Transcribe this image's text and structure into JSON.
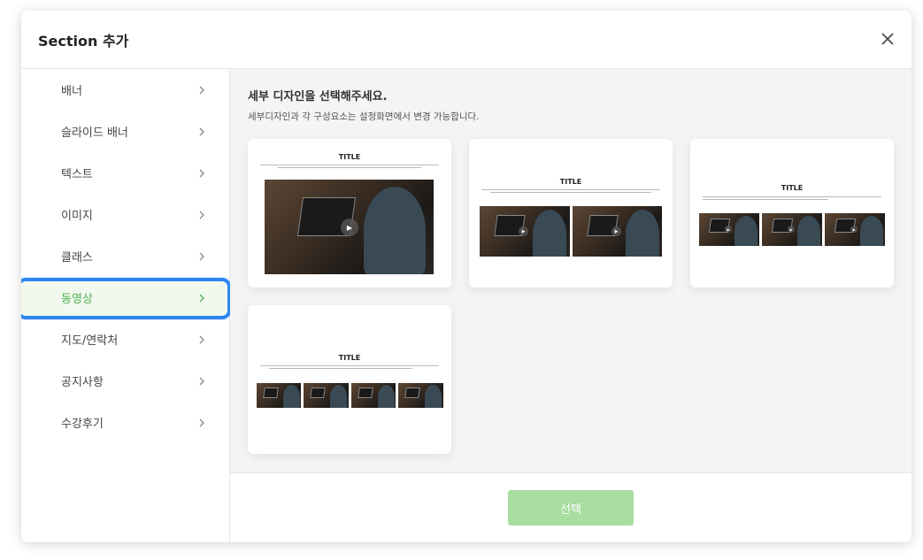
{
  "modal": {
    "title": "Section 추가",
    "close_icon": "close-icon"
  },
  "sidebar": {
    "items": [
      {
        "label": "배너"
      },
      {
        "label": "슬라이드 배너"
      },
      {
        "label": "텍스트"
      },
      {
        "label": "이미지"
      },
      {
        "label": "클래스"
      },
      {
        "label": "동영상",
        "active": true
      },
      {
        "label": "지도/연락처"
      },
      {
        "label": "공지사항"
      },
      {
        "label": "수강후기"
      }
    ],
    "active_color": "#4fb34f",
    "highlight_color": "#2f86f3"
  },
  "content": {
    "title": "세부 디자인을 선택해주세요.",
    "subtitle": "세부디자인과 각 구성요소는 설정화면에서 변경 가능합니다.",
    "cards": [
      {
        "title": "TITLE",
        "thumbnails": 1
      },
      {
        "title": "TITLE",
        "thumbnails": 2
      },
      {
        "title": "TITLE",
        "thumbnails": 3
      },
      {
        "title": "TITLE",
        "thumbnails": 4
      }
    ]
  },
  "footer": {
    "select_label": "선택",
    "button_color": "#a8dea0"
  }
}
